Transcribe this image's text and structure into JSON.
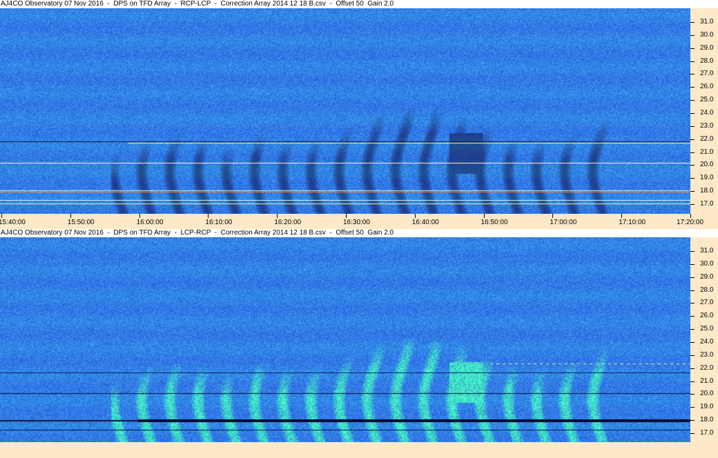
{
  "panels": [
    {
      "title": "AJ4CO Observatory 07 Nov 2016  -  DPS on TFD Array  -  RCP-LCP  -  Correction Array 2014 12 18 B.csv  -  Offset 50  Gain 2.0"
    },
    {
      "title": "AJ4CO Observatory 07 Nov 2016  -  DPS on TFD Array  -  LCP-RCP  -  Correction Array 2014 12 18 B.csv  -  Offset 50  Gain 2.0"
    }
  ],
  "freq_ticks": [
    "31.0",
    "30.0",
    "29.0",
    "28.0",
    "27.0",
    "26.0",
    "25.0",
    "24.0",
    "23.0",
    "22.0",
    "21.0",
    "20.0",
    "19.0",
    "18.0",
    "17.0"
  ],
  "time_ticks": [
    "15:40:00",
    "15:50:00",
    "16:00:00",
    "16:10:00",
    "16:20:00",
    "16:30:00",
    "16:40:00",
    "16:50:00",
    "17:00:00",
    "17:10:00",
    "17:20:00"
  ],
  "colors": {
    "background_blue": "#2a63d8",
    "dark_blue": "#0b2a8a",
    "cyan": "#2ad0e0",
    "axis_bg": "#fde9c8"
  }
}
